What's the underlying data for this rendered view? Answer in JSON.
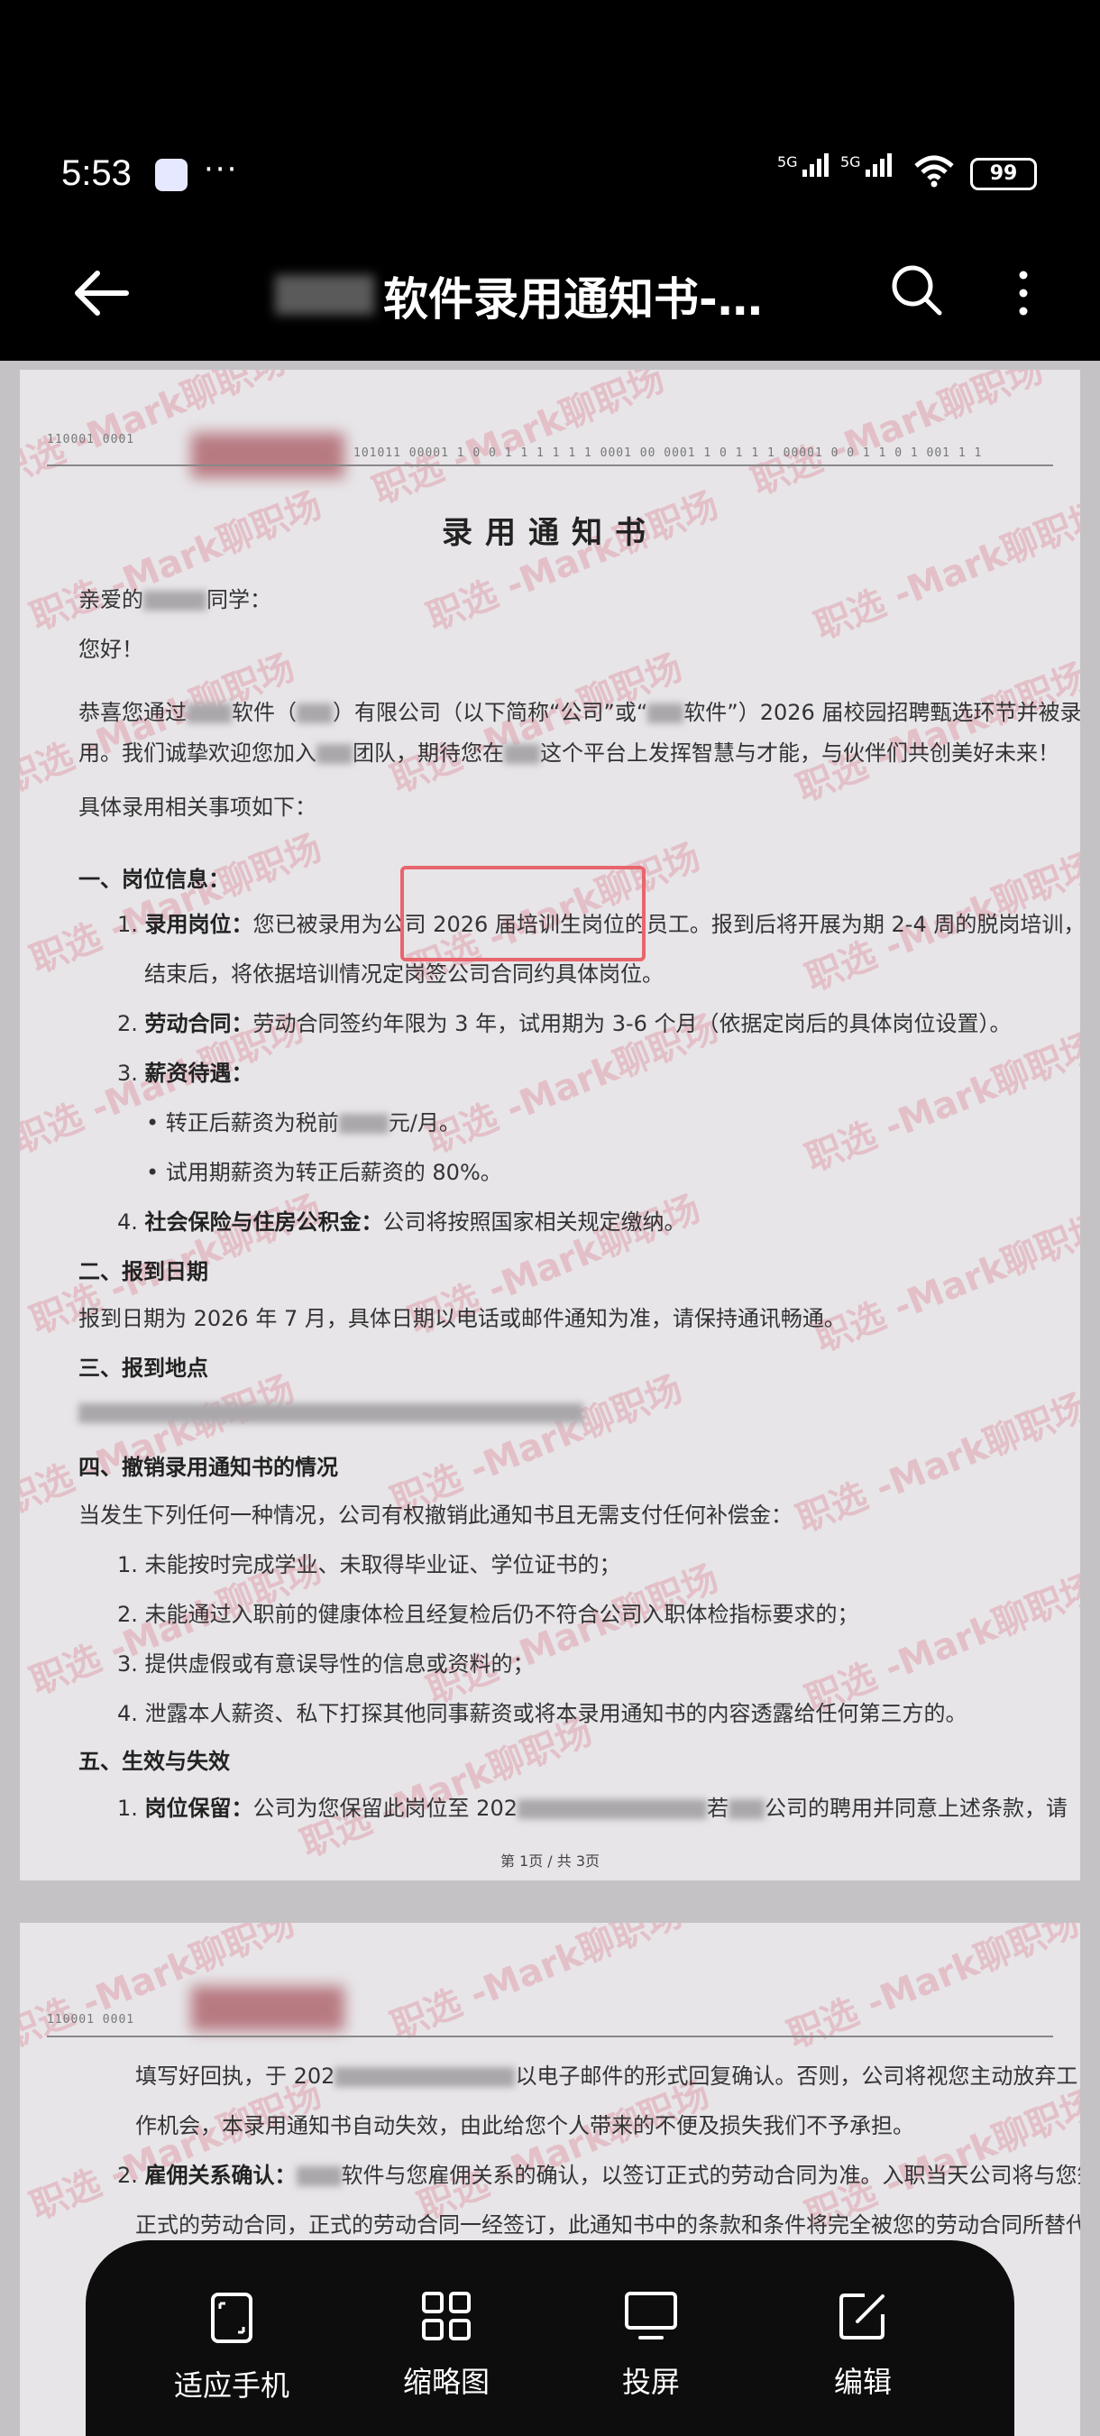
{
  "status": {
    "time": "5:53",
    "dots": "···",
    "signal1": "5G",
    "signal2": "5G",
    "battery": "99"
  },
  "app_bar": {
    "title": "软件录用通知书-…"
  },
  "doc": {
    "header_code": "110001 0001",
    "header_rest": "101011 00001 1 0 0 1 1 1 1 1 1 0001 00 0001 1 0 1 1 1 00001 0 0 1 1 0 1 001 1 1",
    "title": "录用通知书",
    "greeting": "亲爱的",
    "greeting_suffix": "同学：",
    "hello": "您好！",
    "p1a": "恭喜您通过",
    "p1b": "软件（",
    "p1c": "）有限公司（以下简称“公司”或“",
    "p1d": "软件”）2026 届校园招聘甄选环节并被录",
    "p1e": "用。我们诚挚欢迎您加入",
    "p1f": "团队，期待您在",
    "p1g": "这个平台上发挥智慧与才能，与伙伴们共创美好未来！",
    "p2": "具体录用相关事项如下：",
    "s1": "一、岗位信息：",
    "s1_1_num": "1.",
    "s1_1_label": "录用岗位：",
    "s1_1_text": "您已被录用为公司 2026 届培训生岗位的员工。报到后将开展为期 2-4 周的脱岗培训，培训",
    "s1_1_cont": "结束后，将依据培训情况定岗签公司合同约具体岗位。",
    "s1_2_num": "2.",
    "s1_2_label": "劳动合同：",
    "s1_2_text": "劳动合同签约年限为 3 年，试用期为 3-6 个月（依据定岗后的具体岗位设置）。",
    "s1_3_num": "3.",
    "s1_3_label": "薪资待遇：",
    "s1_3_b1a": "• 转正后薪资为税前",
    "s1_3_b1b": "元/月。",
    "s1_3_b2": "• 试用期薪资为转正后薪资的 80%。",
    "s1_4_num": "4.",
    "s1_4_label": "社会保险与住房公积金：",
    "s1_4_text": "公司将按照国家相关规定缴纳。",
    "s2": "二、报到日期",
    "s2_text": "报到日期为 2026 年 7 月，具体日期以电话或邮件通知为准，请保持通讯畅通。",
    "s3": "三、报到地点",
    "s4": "四、撤销录用通知书的情况",
    "s4_text": "当发生下列任何一种情况，公司有权撤销此通知书且无需支付任何补偿金：",
    "s4_1": "1. 未能按时完成学业、未取得毕业证、学位证书的；",
    "s4_2": "2. 未能通过入职前的健康体检且经复检后仍不符合公司入职体检指标要求的；",
    "s4_3": "3. 提供虚假或有意误导性的信息或资料的；",
    "s4_4": "4. 泄露本人薪资、私下打探其他同事薪资或将本录用通知书的内容透露给任何第三方的。",
    "s5": "五、生效与失效",
    "s5_1_num": "1.",
    "s5_1_label": "岗位保留：",
    "s5_1_a": "公司为您保留此岗位至 202",
    "s5_1_b": "若",
    "s5_1_c": "公司的聘用并同意上述条款，请",
    "page_num": "第 1页 / 共 3页",
    "p2_header": "110001 0001",
    "p2_l1a": "填写好回执，于 202",
    "p2_l1b": "以电子邮件的形式回复确认。否则，公司将视您主动放弃工",
    "p2_l2": "作机会，本录用通知书自动失效，由此给您个人带来的不便及损失我们不予承担。",
    "p2_l3_num": "2.",
    "p2_l3_label": "雇佣关系确认：",
    "p2_l3_text": "软件与您雇佣关系的确认，以签订正式的劳动合同为准。入职当天公司将与您签订",
    "p2_l4": "正式的劳动合同，正式的劳动合同一经签订，此通知书中的条款和条件将完全被您的劳动合同所替代，并"
  },
  "watermark_text": "职选 -Mark聊职场",
  "bottom_bar": {
    "fit": "适应手机",
    "thumbs": "缩略图",
    "cast": "投屏",
    "edit": "编辑"
  }
}
